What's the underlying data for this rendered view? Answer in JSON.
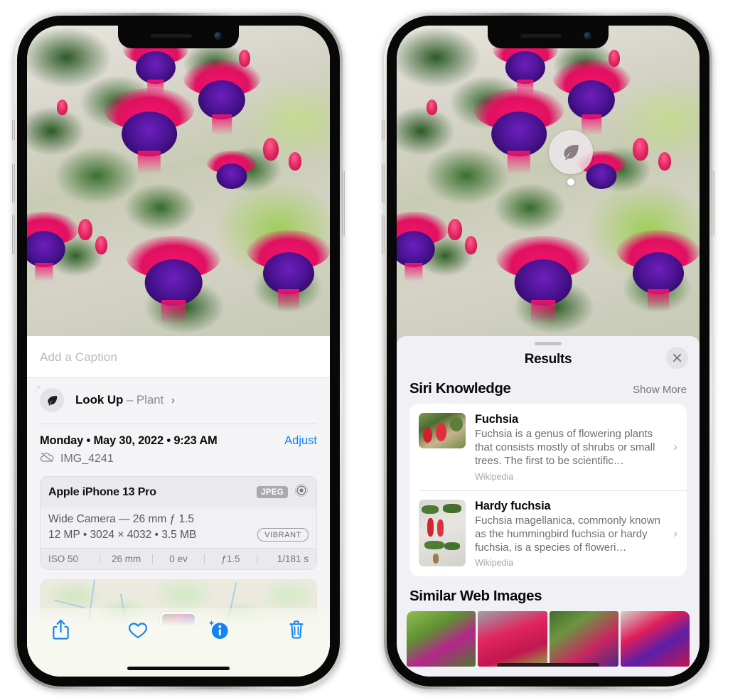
{
  "left_phone": {
    "caption": {
      "placeholder": "Add a Caption",
      "value": ""
    },
    "lookup": {
      "label": "Look Up",
      "dash": "–",
      "subject": "Plant",
      "icon": "leaf-icon",
      "chevron": "›"
    },
    "date": {
      "text": "Monday • May 30, 2022 • 9:23 AM",
      "adjust_label": "Adjust"
    },
    "file": {
      "name": "IMG_4241",
      "icon": "icloud-slash-icon"
    },
    "exif": {
      "model": "Apple iPhone 13 Pro",
      "format_badge": "JPEG",
      "lens_icon": "aperture-icon",
      "lens_line": "Wide Camera — 26 mm ƒ 1.5",
      "specs_line": "12 MP • 3024 × 4032 • 3.5 MB",
      "style_badge": "VIBRANT",
      "stats": [
        "ISO 50",
        "26 mm",
        "0 ev",
        "ƒ1.5",
        "1/181 s"
      ]
    },
    "toolbar": {
      "share_label": "Share",
      "favorite_label": "Favorite",
      "info_label": "Info",
      "delete_label": "Delete"
    }
  },
  "right_phone": {
    "visual_lookup_badge": {
      "icon": "leaf-icon"
    },
    "sheet": {
      "title": "Results",
      "close_label": "Close",
      "siri": {
        "section_title": "Siri Knowledge",
        "show_more": "Show More",
        "items": [
          {
            "title": "Fuchsia",
            "description": "Fuchsia is a genus of flowering plants that consists mostly of shrubs or small trees. The first to be scientific…",
            "source": "Wikipedia",
            "chevron": "›"
          },
          {
            "title": "Hardy fuchsia",
            "description": "Fuchsia magellanica, commonly known as the hummingbird fuchsia or hardy fuchsia, is a species of floweri…",
            "source": "Wikipedia",
            "chevron": "›"
          }
        ]
      },
      "similar": {
        "section_title": "Similar Web Images",
        "thumbs": [
          "web-image-1",
          "web-image-2",
          "web-image-3",
          "web-image-4"
        ]
      }
    }
  },
  "colors": {
    "accent_blue": "#1383f5",
    "sheet_bg": "#f1f0f4",
    "panel_bg": "#f4f4f6",
    "card_white": "#ffffff",
    "secondary_text": "#6e6e75",
    "placeholder": "#b9b9bd"
  }
}
